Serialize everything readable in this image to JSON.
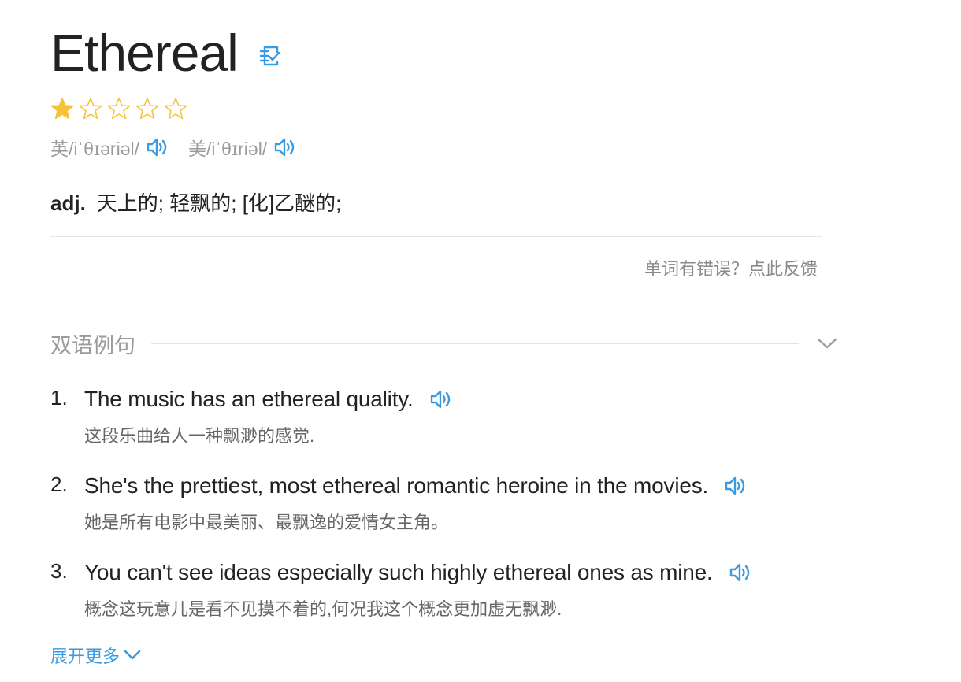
{
  "word": "Ethereal",
  "icons": {
    "wordbook": "add-to-wordbook-icon",
    "speaker": "speaker-icon",
    "star": "star-icon",
    "chevron": "chevron-down-icon"
  },
  "colors": {
    "accent": "#3a9be0",
    "star_filled": "#f5c33b",
    "muted_text": "#9b9b9b"
  },
  "rating": {
    "filled": 1,
    "total": 5
  },
  "phonetics": [
    {
      "label": "英/iˈθɪəriəl/"
    },
    {
      "label": "美/iˈθɪriəl/"
    }
  ],
  "definition": {
    "pos": "adj.",
    "meaning": "天上的; 轻飘的; [化]乙醚的;"
  },
  "feedback_link": "单词有错误？点此反馈",
  "examples_section": {
    "title": "双语例句",
    "items": [
      {
        "num": "1.",
        "en": "The music has an ethereal quality.",
        "zh": "这段乐曲给人一种飘渺的感觉."
      },
      {
        "num": "2.",
        "en": "She's the prettiest, most ethereal romantic heroine in the movies.",
        "zh": "她是所有电影中最美丽、最飘逸的爱情女主角。"
      },
      {
        "num": "3.",
        "en": "You can't see ideas especially such highly ethereal ones as mine.",
        "zh": "概念这玩意儿是看不见摸不着的,何况我这个概念更加虚无飘渺."
      }
    ],
    "more_label": "展开更多"
  }
}
